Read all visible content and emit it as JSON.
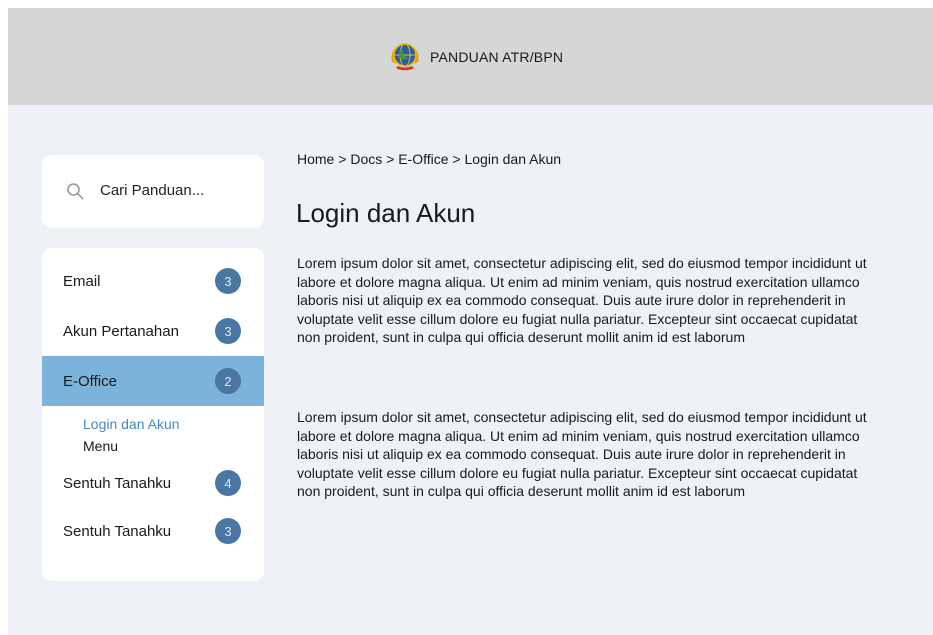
{
  "header": {
    "brand": "PANDUAN ATR/BPN",
    "logo_icon": "atr-bpn-logo-icon"
  },
  "search": {
    "placeholder": "Cari Panduan...",
    "icon": "search-icon"
  },
  "sidebar": {
    "items": [
      {
        "label": "Email",
        "count": "3",
        "active": false
      },
      {
        "label": "Akun Pertanahan",
        "count": "3",
        "active": false
      },
      {
        "label": "E-Office",
        "count": "2",
        "active": true
      },
      {
        "label": "Sentuh Tanahku",
        "count": "4",
        "active": false
      },
      {
        "label": "Sentuh Tanahku",
        "count": "3",
        "active": false
      }
    ],
    "subitems": [
      {
        "label": "Login dan Akun",
        "current": true
      },
      {
        "label": "Menu",
        "current": false
      }
    ]
  },
  "breadcrumb": {
    "items": [
      "Home",
      "Docs",
      "E-Office",
      "Login dan Akun"
    ],
    "separator": ">"
  },
  "page": {
    "title": "Login dan Akun",
    "paragraphs": [
      "Lorem ipsum dolor sit amet, consectetur adipiscing elit, sed do eiusmod tempor incididunt ut labore et dolore magna aliqua. Ut enim ad minim veniam, quis nostrud exercitation ullamco laboris nisi ut aliquip ex ea commodo consequat. Duis aute irure dolor in reprehenderit in voluptate velit esse cillum dolore eu fugiat nulla pariatur. Excepteur sint occaecat cupidatat non proident, sunt in culpa qui officia deserunt mollit anim id est laborum",
      "Lorem ipsum dolor sit amet, consectetur adipiscing elit, sed do eiusmod tempor incididunt ut labore et dolore magna aliqua. Ut enim ad minim veniam, quis nostrud exercitation ullamco laboris nisi ut aliquip ex ea commodo consequat. Duis aute irure dolor in reprehenderit in voluptate velit esse cillum dolore eu fugiat nulla pariatur. Excepteur sint occaecat cupidatat non proident, sunt in culpa qui officia deserunt mollit anim id est laborum"
    ]
  },
  "colors": {
    "header_bg": "#d6d6d6",
    "page_bg": "#eef1f6",
    "active_item_bg": "#7cb3da",
    "badge_bg": "#4a76a3",
    "current_link": "#4a87c2"
  }
}
